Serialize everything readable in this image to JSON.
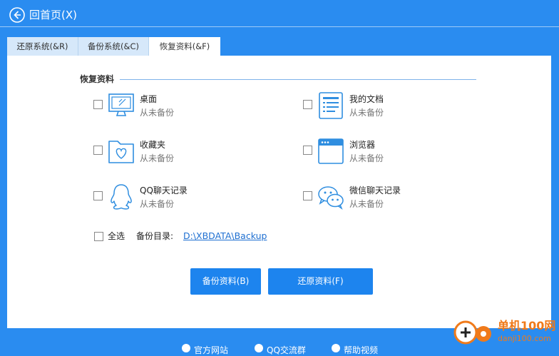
{
  "header": {
    "back_label": "回首页(X)"
  },
  "tabs": [
    {
      "label": "还原系统(&R)",
      "active": false
    },
    {
      "label": "备份系统(&C)",
      "active": false
    },
    {
      "label": "恢复资料(&F)",
      "active": true
    }
  ],
  "section": {
    "title": "恢复资料"
  },
  "items": [
    {
      "name": "桌面",
      "status": "从未备份",
      "icon": "monitor-icon",
      "checked": false
    },
    {
      "name": "我的文档",
      "status": "从未备份",
      "icon": "document-icon",
      "checked": false
    },
    {
      "name": "收藏夹",
      "status": "从未备份",
      "icon": "favorites-folder-icon",
      "checked": false
    },
    {
      "name": "浏览器",
      "status": "从未备份",
      "icon": "browser-icon",
      "checked": false
    },
    {
      "name": "QQ聊天记录",
      "status": "从未备份",
      "icon": "qq-icon",
      "checked": false
    },
    {
      "name": "微信聊天记录",
      "status": "从未备份",
      "icon": "wechat-icon",
      "checked": false
    }
  ],
  "select_all": {
    "label": "全选",
    "checked": false
  },
  "backup_dir": {
    "label": "备份目录:",
    "path": "D:\\XBDATA\\Backup"
  },
  "buttons": {
    "backup": "备份资料(B)",
    "restore": "还原资料(F)"
  },
  "footer": {
    "website": "官方网站",
    "qq_group": "QQ交流群",
    "help_video": "帮助视频"
  },
  "watermark": {
    "text": "单机100网",
    "sub": "danji100.com"
  },
  "colors": {
    "background": "#2a8cf0",
    "accent": "#1d84ee",
    "icon": "#2f8ee0",
    "link": "#1e6fd1"
  }
}
